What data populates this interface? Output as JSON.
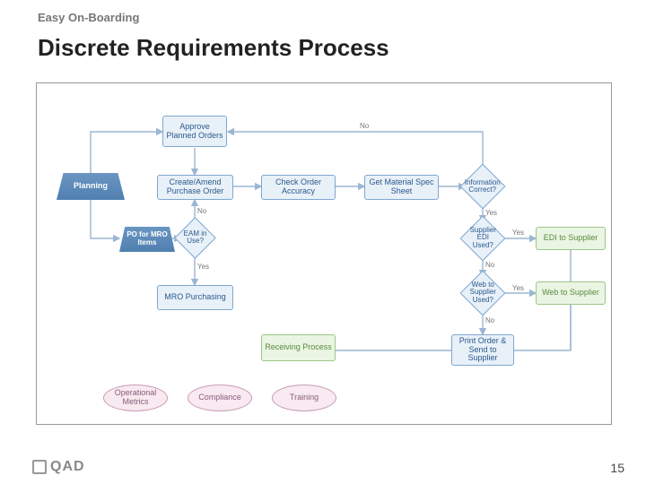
{
  "header": {
    "subtitle": "Easy On-Boarding",
    "title": "Discrete Requirements Process"
  },
  "nodes": {
    "planning": "Planning",
    "approve": "Approve Planned Orders",
    "create": "Create/Amend Purchase Order",
    "po_mro": "PO for MRO Items",
    "eam": "EAM in Use?",
    "mro_purchasing": "MRO Purchasing",
    "check": "Check Order Accuracy",
    "spec": "Get Material Spec Sheet",
    "info": "Information Correct?",
    "edi_q": "Supplier EDI Used?",
    "edi": "EDI to Supplier",
    "web_q": "Web to Supplier Used?",
    "web": "Web to Supplier",
    "print": "Print Order & Send to Supplier",
    "receiving": "Receiving Process",
    "metrics": "Operational Metrics",
    "compliance": "Compliance",
    "training": "Training"
  },
  "labels": {
    "no": "No",
    "yes": "Yes",
    "no_s": "No"
  },
  "footer": {
    "logo": "QAD",
    "page": "15"
  }
}
